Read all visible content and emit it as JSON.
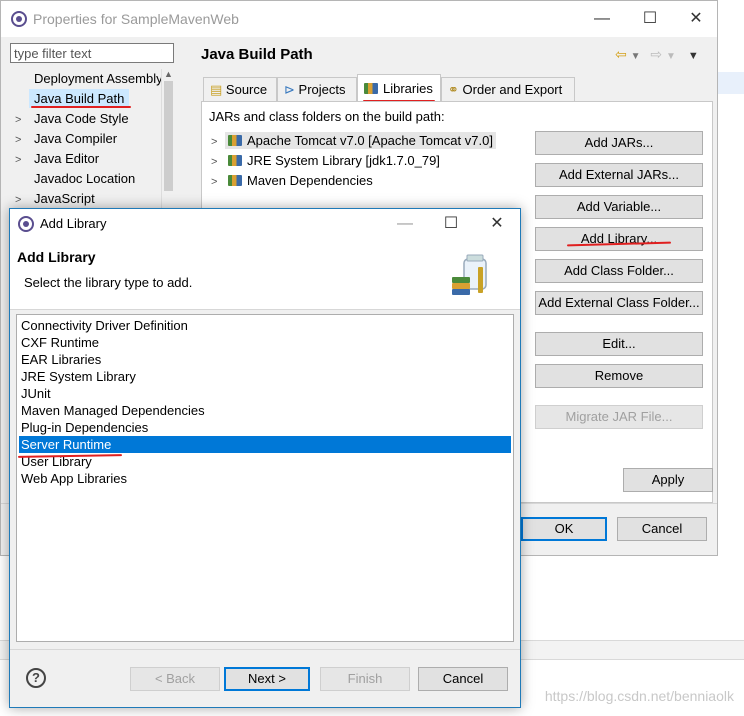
{
  "properties_window": {
    "title": "Properties for SampleMavenWeb",
    "filter_placeholder": "type filter text",
    "tree_items": [
      {
        "label": "Deployment Assembly",
        "chevron": ""
      },
      {
        "label": "Java Build Path",
        "chevron": ""
      },
      {
        "label": "Java Code Style",
        "chevron": ">"
      },
      {
        "label": "Java Compiler",
        "chevron": ">"
      },
      {
        "label": "Java Editor",
        "chevron": ">"
      },
      {
        "label": "Javadoc Location",
        "chevron": ""
      },
      {
        "label": "JavaScript",
        "chevron": ">"
      }
    ],
    "page_title": "Java Build Path",
    "tabs": [
      "Source",
      "Projects",
      "Libraries",
      "Order and Export"
    ],
    "panel_label": "JARs and class folders on the build path:",
    "jar_tree": [
      "Apache Tomcat v7.0 [Apache Tomcat v7.0]",
      "JRE System Library [jdk1.7.0_79]",
      "Maven Dependencies"
    ],
    "buttons": {
      "add_jars": "Add JARs...",
      "add_external_jars": "Add External JARs...",
      "add_variable": "Add Variable...",
      "add_library": "Add Library...",
      "add_class_folder": "Add Class Folder...",
      "add_external_class_folder": "Add External Class Folder...",
      "edit": "Edit...",
      "remove": "Remove",
      "migrate_jar": "Migrate JAR File...",
      "apply": "Apply",
      "ok": "OK",
      "cancel": "Cancel"
    }
  },
  "add_library_dialog": {
    "title": "Add Library",
    "heading": "Add Library",
    "description": "Select the library type to add.",
    "library_types": [
      "Connectivity Driver Definition",
      "CXF Runtime",
      "EAR Libraries",
      "JRE System Library",
      "JUnit",
      "Maven Managed Dependencies",
      "Plug-in Dependencies",
      "Server Runtime",
      "User Library",
      "Web App Libraries"
    ],
    "selected_index": 7,
    "buttons": {
      "back": "< Back",
      "next": "Next >",
      "finish": "Finish",
      "cancel": "Cancel"
    }
  },
  "watermark": "https://blog.csdn.net/benniaolk",
  "colors": {
    "selection": "#0078d7",
    "annotation_red": "#e02020",
    "dialog_border": "#1f7ab8"
  }
}
